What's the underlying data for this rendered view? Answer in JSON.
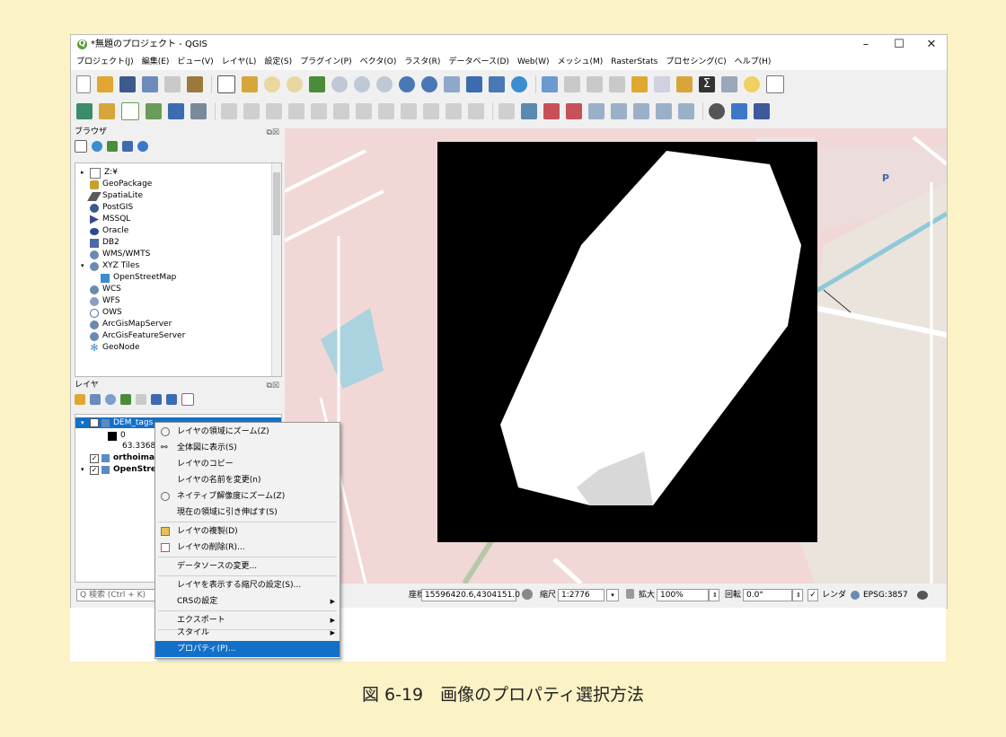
{
  "window": {
    "title": "*無題のプロジェクト - QGIS",
    "controls": {
      "minimize": "–",
      "maximize": "☐",
      "close": "✕"
    }
  },
  "menubar": [
    "プロジェクト(J)",
    "編集(E)",
    "ビュー(V)",
    "レイヤ(L)",
    "設定(S)",
    "プラグイン(P)",
    "ベクタ(O)",
    "ラスタ(R)",
    "データベース(D)",
    "Web(W)",
    "メッシュ(M)",
    "RasterStats",
    "プロセシング(C)",
    "ヘルプ(H)"
  ],
  "browser_panel": {
    "title": "ブラウザ",
    "items": [
      "Z:¥",
      "GeoPackage",
      "SpatiaLite",
      "PostGIS",
      "MSSQL",
      "Oracle",
      "DB2",
      "WMS/WMTS",
      "XYZ Tiles",
      "OpenStreetMap",
      "WCS",
      "WFS",
      "OWS",
      "ArcGisMapServer",
      "ArcGisFeatureServer",
      "GeoNode"
    ]
  },
  "layers_panel": {
    "title": "レイヤ",
    "layers": [
      {
        "name": "DEM_tags",
        "selected": true
      },
      {
        "legend_min": "0",
        "legend_max": "63.3368"
      },
      {
        "name": "orthoimag"
      },
      {
        "name": "OpenStree"
      }
    ]
  },
  "context_menu": [
    "レイヤの領域にズーム(Z)",
    "全体図に表示(S)",
    "レイヤのコピー",
    "レイヤの名前を変更(n)",
    "ネイティブ解像度にズーム(Z)",
    "現在の領域に引き伸ばす(S)",
    "レイヤの複製(D)",
    "レイヤの削除(R)...",
    "データソースの変更...",
    "レイヤを表示する縮尺の設定(S)...",
    "CRSの設定",
    "エクスポート",
    "スタイル",
    "プロパティ(P)..."
  ],
  "statusbar": {
    "search_placeholder": "Q 検索 (Ctrl + K)",
    "coord_label": "座標",
    "coord_value": "15596420.6,4304151.0",
    "scale_label": "縮尺",
    "scale_value": "1:2776",
    "magnifier_label": "拡大",
    "magnifier_value": "100%",
    "rotation_label": "回転",
    "rotation_value": "0.0°",
    "render_label": "レンダ",
    "crs": "EPSG:3857"
  },
  "map": {
    "parking_label": "P"
  },
  "caption": "図 6-19　画像のプロパティ選択方法",
  "colors": {
    "background": "#fbf2c6",
    "selection": "#1370c9",
    "map": "#f2d7d7"
  }
}
